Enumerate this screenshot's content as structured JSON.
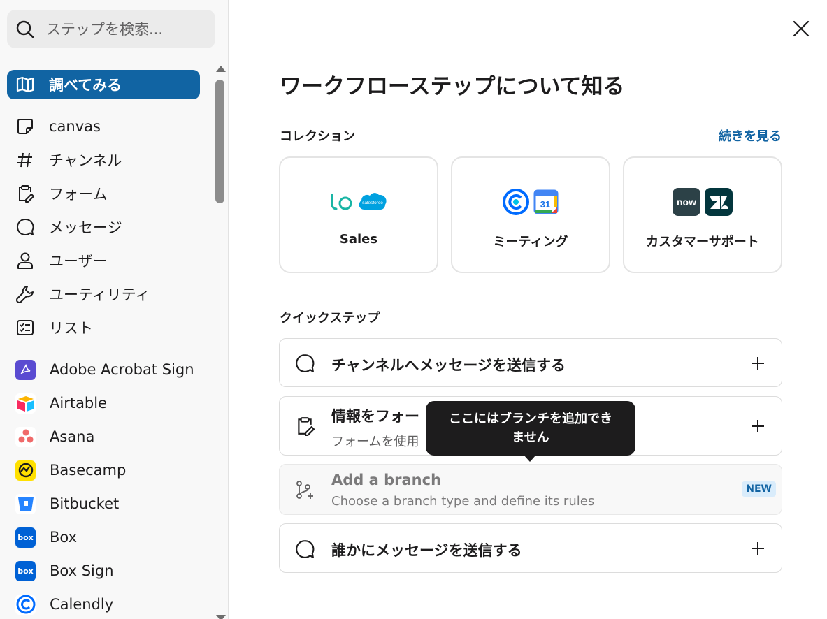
{
  "search": {
    "placeholder": "ステップを検索..."
  },
  "sidebar": {
    "items": [
      {
        "label": "調べてみる",
        "icon": "book-icon",
        "active": true
      },
      {
        "label": "canvas",
        "icon": "canvas-icon"
      },
      {
        "label": "チャンネル",
        "icon": "hash-icon"
      },
      {
        "label": "フォーム",
        "icon": "form-icon"
      },
      {
        "label": "メッセージ",
        "icon": "message-icon"
      },
      {
        "label": "ユーザー",
        "icon": "user-icon"
      },
      {
        "label": "ユーティリティ",
        "icon": "wrench-icon"
      },
      {
        "label": "リスト",
        "icon": "list-icon"
      }
    ],
    "apps": [
      {
        "label": "Adobe Acrobat Sign",
        "icon": "adobe-acrobat-sign-icon",
        "color": "#5a4bd1"
      },
      {
        "label": "Airtable",
        "icon": "airtable-icon"
      },
      {
        "label": "Asana",
        "icon": "asana-icon",
        "color": "#f06a6a"
      },
      {
        "label": "Basecamp",
        "icon": "basecamp-icon",
        "color": "#ffe000"
      },
      {
        "label": "Bitbucket",
        "icon": "bitbucket-icon",
        "color": "#2684ff"
      },
      {
        "label": "Box",
        "icon": "box-icon",
        "color": "#0061d5"
      },
      {
        "label": "Box Sign",
        "icon": "box-sign-icon",
        "color": "#0061d5"
      },
      {
        "label": "Calendly",
        "icon": "calendly-icon",
        "color": "#006bff"
      }
    ]
  },
  "main": {
    "title": "ワークフローステップについて知る",
    "collections": {
      "heading": "コレクション",
      "see_more": "続きを見る",
      "cards": [
        {
          "label": "Sales",
          "logos": [
            "lo-logo",
            "salesforce-logo"
          ],
          "salesforce_text": "salesforce"
        },
        {
          "label": "ミーティング",
          "logos": [
            "calendly-logo",
            "google-calendar-logo"
          ],
          "calendar_day": "31"
        },
        {
          "label": "カスタマーサポート",
          "logos": [
            "servicenow-logo",
            "zendesk-logo"
          ],
          "servicenow_text": "now"
        }
      ]
    },
    "quick_steps": {
      "heading": "クイックステップ",
      "steps": [
        {
          "title": "チャンネルへメッセージを送信する"
        },
        {
          "title": "情報をフォー",
          "subtitle": "フォームを使用"
        },
        {
          "title": "Add a branch",
          "subtitle": "Choose a branch type and define its rules",
          "badge": "NEW"
        },
        {
          "title": "誰かにメッセージを送信する"
        }
      ]
    },
    "tooltip": {
      "line1": "ここにはブランチを追加でき",
      "line2": "ません"
    }
  },
  "colors": {
    "accent": "#1164a3",
    "link": "#1264a3",
    "tooltip_bg": "#1d1c1d"
  }
}
